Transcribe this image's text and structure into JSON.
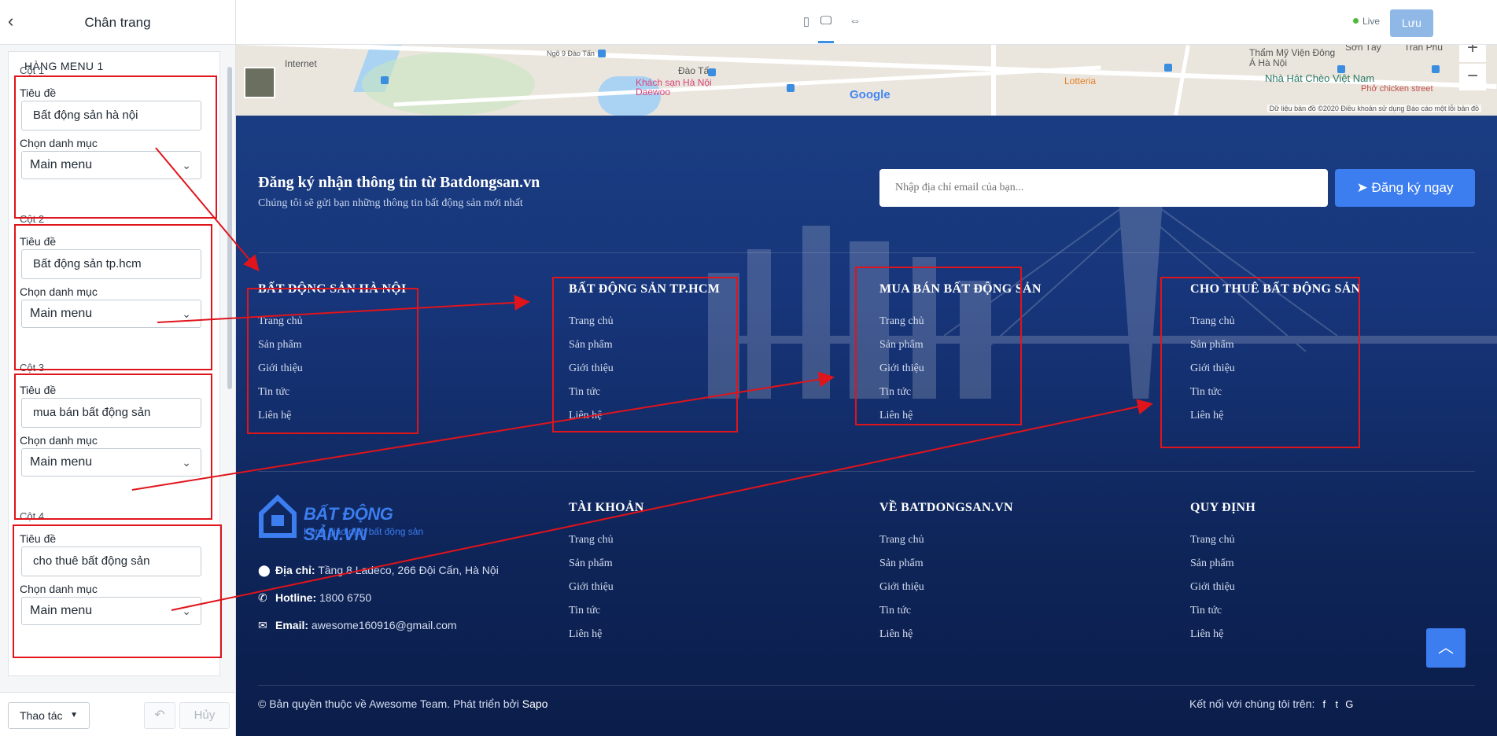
{
  "sidebar": {
    "title": "Chân trang",
    "section_title": "HÀNG MENU 1",
    "title_label": "Tiêu đề",
    "category_label": "Chọn danh mục",
    "columns": [
      {
        "label": "Cột 1",
        "title_value": "Bất động sản hà nội",
        "category_value": "Main menu"
      },
      {
        "label": "Cột 2",
        "title_value": "Bất động sản tp.hcm",
        "category_value": "Main menu"
      },
      {
        "label": "Cột 3",
        "title_value": "mua bán bất động sản",
        "category_value": "Main menu"
      },
      {
        "label": "Cột 4",
        "title_value": "cho thuê bất động sản",
        "category_value": "Main menu"
      }
    ],
    "footer": {
      "actions_label": "Thao tác",
      "cancel_label": "Hủy"
    }
  },
  "topbar": {
    "live_label": "Live",
    "save_label": "Lưu"
  },
  "map": {
    "labels": [
      "Internet",
      "Ngõ 9 Đào Tấn",
      "Đào Tấn",
      "Khách sạn Hà Nội Daewoo",
      "Thẩm Mỹ Viện Đông Á Hà Nội",
      "Sơn Tây",
      "Trần Phú",
      "Nhà Hát Chèo Việt Nam",
      "Lotteria",
      "Phở chicken street"
    ],
    "google": "Google",
    "attribution": "Dữ liệu bản đồ ©2020   Điều khoản sử dụng   Báo cáo một lỗi bản đồ"
  },
  "newsletter": {
    "title": "Đăng ký nhận thông tin từ Batdongsan.vn",
    "subtitle": "Chúng tôi sẽ gửi bạn những thông tin bất động sản mới nhất",
    "placeholder": "Nhập địa chỉ email của bạn...",
    "button": "Đăng ký ngay"
  },
  "menu_row_1": [
    {
      "heading": "BẤT ĐỘNG SẢN HÀ NỘI",
      "items": [
        "Trang chủ",
        "Sản phẩm",
        "Giới thiệu",
        "Tin tức",
        "Liên hệ"
      ]
    },
    {
      "heading": "BẤT ĐỘNG SẢN TP.HCM",
      "items": [
        "Trang chủ",
        "Sản phẩm",
        "Giới thiệu",
        "Tin tức",
        "Liên hệ"
      ]
    },
    {
      "heading": "MUA BÁN BẤT ĐỘNG SẢN",
      "items": [
        "Trang chủ",
        "Sản phẩm",
        "Giới thiệu",
        "Tin tức",
        "Liên hệ"
      ]
    },
    {
      "heading": "CHO THUÊ BẤT ĐỘNG SẢN",
      "items": [
        "Trang chủ",
        "Sản phẩm",
        "Giới thiệu",
        "Tin tức",
        "Liên hệ"
      ]
    }
  ],
  "brand": {
    "name": "BẤT ĐỘNG SẢN.VN",
    "slogan": "Kênh giao dịch bất động sản"
  },
  "contact": {
    "address_label": "Địa chỉ:",
    "address": "Tầng 8 Ladeco, 266 Đội Cấn, Hà Nội",
    "hotline_label": "Hotline:",
    "hotline": "1800 6750",
    "email_label": "Email:",
    "email": "awesome160916@gmail.com"
  },
  "menu_row_2": [
    {
      "heading": "TÀI KHOẢN",
      "items": [
        "Trang chủ",
        "Sản phẩm",
        "Giới thiệu",
        "Tin tức",
        "Liên hệ"
      ]
    },
    {
      "heading": "VỀ BATDONGSAN.VN",
      "items": [
        "Trang chủ",
        "Sản phẩm",
        "Giới thiệu",
        "Tin tức",
        "Liên hệ"
      ]
    },
    {
      "heading": "QUY ĐỊNH",
      "items": [
        "Trang chủ",
        "Sản phẩm",
        "Giới thiệu",
        "Tin tức",
        "Liên hệ"
      ]
    }
  ],
  "bottom": {
    "copyright": "© Bản quyền thuộc về Awesome Team. Phát triển bởi",
    "developer": "Sapo",
    "social_label": "Kết nối với chúng tôi trên:"
  },
  "colors": {
    "accent": "#3c7df0",
    "footer_bg": "#17357a",
    "annotation": "#e0141b"
  },
  "icons": [
    "back-arrow-icon",
    "mobile-icon",
    "desktop-icon",
    "fullwidth-icon",
    "paper-plane-icon",
    "map-pin-icon",
    "phone-icon",
    "envelope-icon",
    "facebook-icon",
    "twitter-icon",
    "google-icon",
    "arrow-up-icon",
    "undo-icon",
    "chevron-down-icon"
  ]
}
